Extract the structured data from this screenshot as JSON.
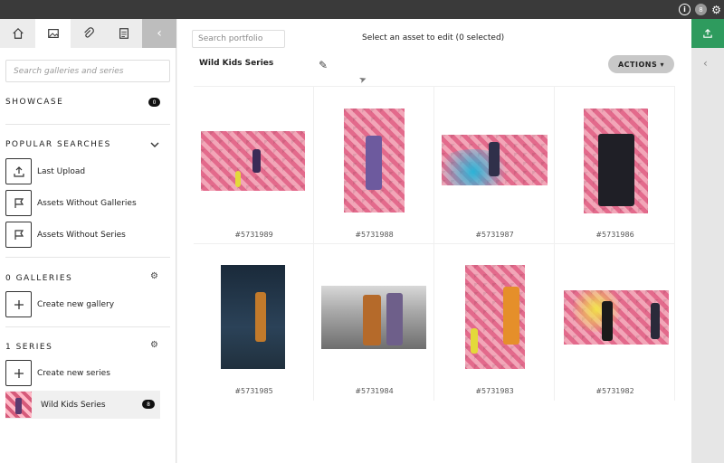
{
  "topbar": {
    "info_icon": "info-icon",
    "badge_count": "8",
    "gear_icon": "gear-icon"
  },
  "sidebar": {
    "tabs": [
      {
        "icon": "home-icon"
      },
      {
        "icon": "image-icon"
      },
      {
        "icon": "paperclip-icon"
      },
      {
        "icon": "document-icon"
      },
      {
        "icon": "chevron-left-icon"
      }
    ],
    "search_placeholder": "Search galleries and series",
    "showcase": {
      "title": "SHOWCASE",
      "count": "0"
    },
    "popular": {
      "title": "POPULAR SEARCHES",
      "items": [
        {
          "label": "Last Upload",
          "icon": "upload-icon"
        },
        {
          "label": "Assets Without Galleries",
          "icon": "flag-icon"
        },
        {
          "label": "Assets Without Series",
          "icon": "flag-icon"
        }
      ]
    },
    "galleries": {
      "title": "0 GALLERIES",
      "create_label": "Create new gallery"
    },
    "series": {
      "title": "1 SERIES",
      "create_label": "Create new series",
      "items": [
        {
          "label": "Wild Kids Series",
          "count": "8"
        }
      ]
    }
  },
  "main": {
    "search_placeholder": "Search portfolio",
    "status": "Select an asset to edit (0 selected)",
    "series_title": "Wild Kids Series",
    "actions_label": "ACTIONS ▾",
    "assets": [
      {
        "id": "#5731989"
      },
      {
        "id": "#5731988"
      },
      {
        "id": "#5731987"
      },
      {
        "id": "#5731986"
      },
      {
        "id": "#5731985"
      },
      {
        "id": "#5731984"
      },
      {
        "id": "#5731983"
      },
      {
        "id": "#5731982"
      }
    ]
  },
  "right_rail": {
    "upload_icon": "upload-icon",
    "chevron_icon": "chevron-left-icon"
  },
  "colors": {
    "accent": "#2e9b5e",
    "topbar": "#3a3a3a",
    "pink": "#e36a8c"
  }
}
